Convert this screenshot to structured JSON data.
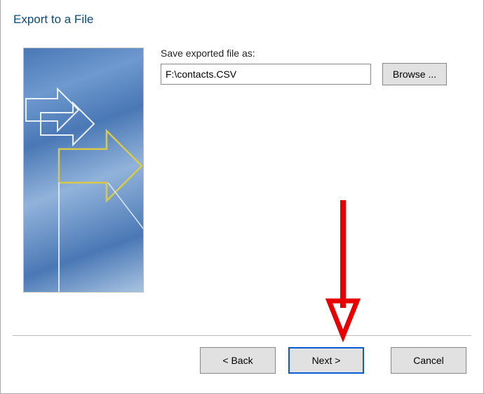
{
  "title": "Export to a File",
  "form": {
    "file_label": "Save exported file as:",
    "file_value": "F:\\contacts.CSV",
    "browse_label": "Browse ..."
  },
  "buttons": {
    "back": "< Back",
    "next": "Next >",
    "cancel": "Cancel"
  }
}
